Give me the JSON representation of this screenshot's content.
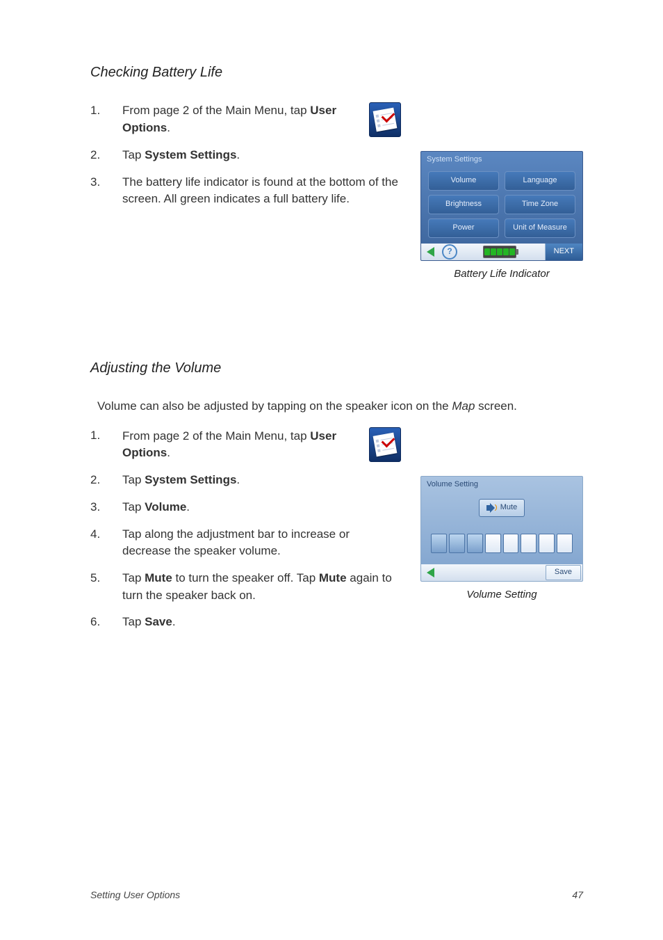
{
  "section1": {
    "title": "Checking Battery Life",
    "steps": [
      {
        "n": "1",
        "pre": "From page 2 of the Main Menu, tap ",
        "bold": "User Options",
        "post": "."
      },
      {
        "n": "2",
        "pre": "Tap ",
        "bold": "System Settings",
        "post": "."
      },
      {
        "n": "3",
        "pre": "The battery life indicator is found at the bottom of the screen.  All green indicates a full battery life.",
        "bold": "",
        "post": ""
      }
    ],
    "screen": {
      "title": "System Settings",
      "buttons": [
        "Volume",
        "Language",
        "Brightness",
        "Time Zone",
        "Power",
        "Unit of Measure"
      ],
      "next": "NEXT"
    },
    "caption": "Battery Life Indicator"
  },
  "section2": {
    "title": "Adjusting the Volume",
    "intro_pre": "Volume can also be adjusted by tapping on the speaker icon on the ",
    "intro_em": "Map",
    "intro_post": " screen.",
    "steps": [
      {
        "n": "1",
        "pre": "From page 2 of the Main Menu, tap ",
        "bold": "User Options",
        "post": "."
      },
      {
        "n": "2",
        "pre": "Tap ",
        "bold": "System Settings",
        "post": "."
      },
      {
        "n": "3",
        "pre": "Tap ",
        "bold": "Volume",
        "post": "."
      },
      {
        "n": "4",
        "pre": "Tap along the adjustment bar to increase or decrease the speaker volume.",
        "bold": "",
        "post": ""
      },
      {
        "n": "5",
        "pre": "Tap ",
        "bold": "Mute",
        "mid": " to turn the speaker off.  Tap ",
        "bold2": "Mute",
        "post": " again to turn the speaker back on."
      },
      {
        "n": "6",
        "pre": "Tap ",
        "bold": "Save",
        "post": "."
      }
    ],
    "screen": {
      "title": "Volume Setting",
      "mute": "Mute",
      "save": "Save",
      "filled": 3,
      "total": 8
    },
    "caption": "Volume Setting"
  },
  "footer": {
    "left": "Setting User Options",
    "right": "47"
  }
}
